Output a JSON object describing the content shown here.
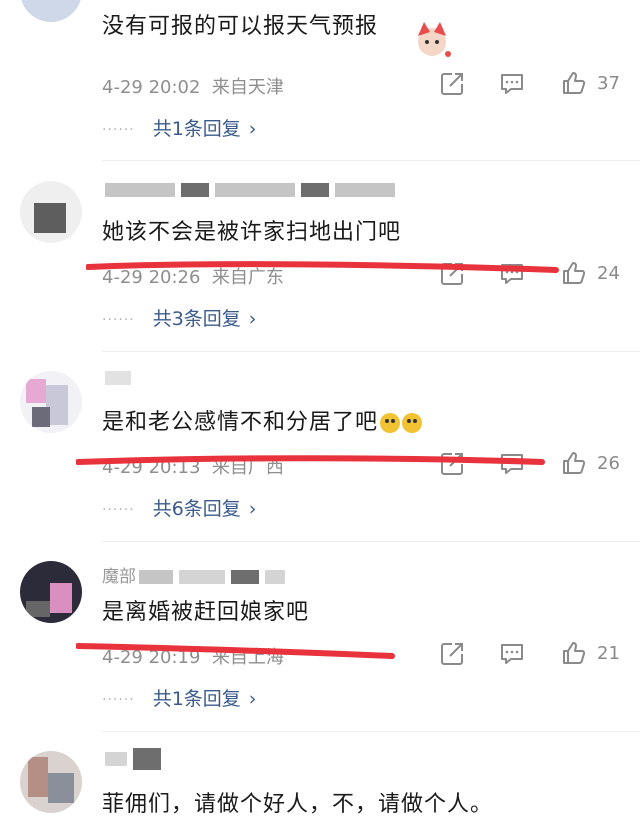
{
  "comments": [
    {
      "username": "",
      "text": "没有可报的可以报天气预报",
      "time": "4-29 20:02",
      "location": "来自天津",
      "likes": "37",
      "replies": "共1条回复"
    },
    {
      "username": "",
      "text": "她该不会是被许家扫地出门吧",
      "time": "4-29 20:26",
      "location": "来自广东",
      "likes": "24",
      "replies": "共3条回复"
    },
    {
      "username": "",
      "text": "是和老公感情不和分居了吧",
      "time": "4-29 20:13",
      "location": "来自广西",
      "likes": "26",
      "replies": "共6条回复"
    },
    {
      "username": "魔部",
      "text": "是离婚被赶回娘家吧",
      "time": "4-29 20:19",
      "location": "来自上海",
      "likes": "21",
      "replies": "共1条回复"
    },
    {
      "username": "",
      "text": "菲佣们，请做个好人，不，请做个人。"
    }
  ],
  "icons": {
    "share": "share-icon",
    "comment": "comment-icon",
    "like": "thumbs-up-icon"
  },
  "colors": {
    "reply_link": "#3b5b8c",
    "red_annotation": "#e8323c",
    "meta_gray": "#8e8e8e"
  }
}
